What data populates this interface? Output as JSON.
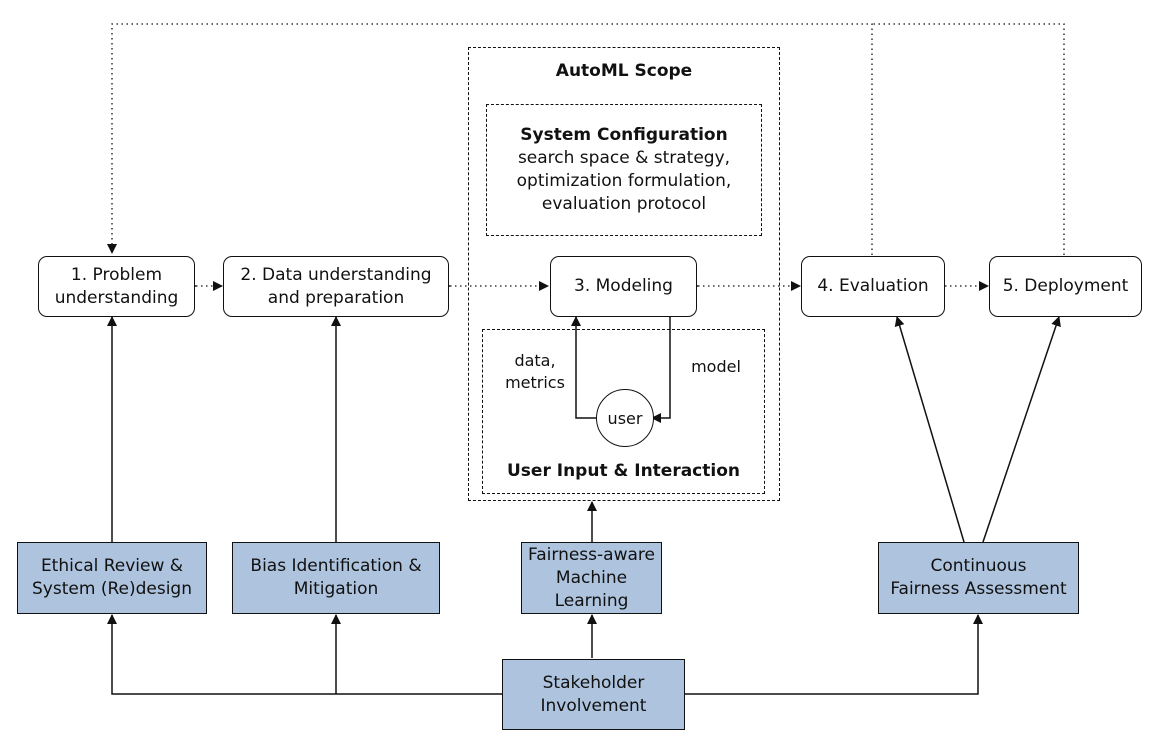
{
  "diagram": {
    "automl_scope": {
      "title": "AutoML Scope",
      "system_configuration": {
        "title": "System Configuration",
        "lines": [
          "search space & strategy,",
          "optimization formulation,",
          "evaluation protocol"
        ]
      },
      "user_interaction": {
        "title": "User Input & Interaction",
        "user_node": "user",
        "edge_to_modeling": [
          "data,",
          "metrics"
        ],
        "edge_to_user": "model"
      }
    },
    "phases": [
      {
        "id": "p1",
        "lines": [
          "1. Problem",
          "understanding"
        ]
      },
      {
        "id": "p2",
        "lines": [
          "2. Data understanding",
          "and preparation"
        ]
      },
      {
        "id": "p3",
        "lines": [
          "3. Modeling"
        ]
      },
      {
        "id": "p4",
        "lines": [
          "4. Evaluation"
        ]
      },
      {
        "id": "p5",
        "lines": [
          "5. Deployment"
        ]
      }
    ],
    "fairness_boxes": [
      {
        "id": "f1",
        "lines": [
          "Ethical Review &",
          "System (Re)design"
        ],
        "targets": [
          "p1"
        ]
      },
      {
        "id": "f2",
        "lines": [
          "Bias Identification &",
          "Mitigation"
        ],
        "targets": [
          "p2"
        ]
      },
      {
        "id": "f3",
        "lines": [
          "Fairness-aware",
          "Machine Learning"
        ],
        "targets": [
          "automl_scope"
        ]
      },
      {
        "id": "f4",
        "lines": [
          "Continuous",
          "Fairness Assessment"
        ],
        "targets": [
          "p4",
          "p5"
        ]
      }
    ],
    "stakeholder": {
      "label": "Stakeholder Involvement",
      "targets": [
        "f1",
        "f2",
        "f3",
        "f4"
      ]
    },
    "feedback_loops": {
      "from": [
        "p4",
        "p5"
      ],
      "to": "p1",
      "style": "dotted"
    },
    "colors": {
      "fairness_fill": "#adc3de",
      "stroke": "#111111",
      "background": "#ffffff"
    }
  }
}
